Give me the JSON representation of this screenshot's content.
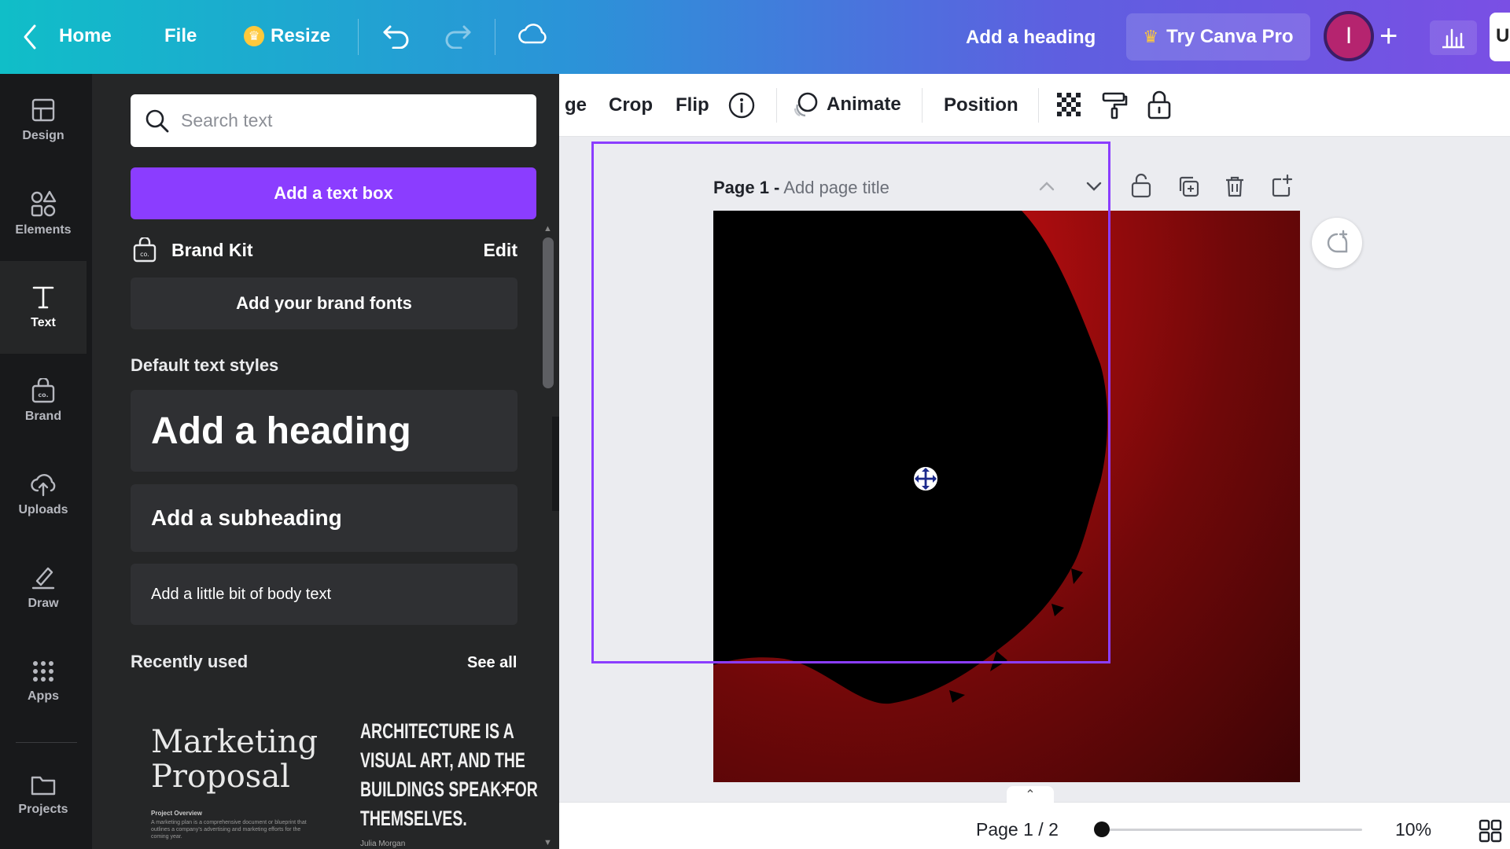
{
  "app": {
    "accent_color": "#8b3dff",
    "topbar": {
      "home_label": "Home",
      "file_label": "File",
      "resize_label": "Resize",
      "design_title": "Add a heading",
      "pro_label": "Try Canva Pro",
      "avatar_initial": "I",
      "share_label": "U"
    }
  },
  "rail": {
    "items": [
      {
        "label": "Design",
        "icon": "layout-icon"
      },
      {
        "label": "Elements",
        "icon": "shapes-icon"
      },
      {
        "label": "Text",
        "icon": "text-icon",
        "active": true
      },
      {
        "label": "Brand",
        "icon": "brand-icon"
      },
      {
        "label": "Uploads",
        "icon": "upload-icon"
      },
      {
        "label": "Draw",
        "icon": "draw-icon"
      },
      {
        "label": "Apps",
        "icon": "apps-icon"
      },
      {
        "label": "Projects",
        "icon": "folder-icon"
      }
    ]
  },
  "panel": {
    "search_placeholder": "Search text",
    "add_text_box": "Add a text box",
    "brand_kit_label": "Brand Kit",
    "brand_kit_edit": "Edit",
    "brand_fonts_button": "Add your brand fonts",
    "default_styles_title": "Default text styles",
    "heading_sample": "Add a heading",
    "subheading_sample": "Add a subheading",
    "body_sample": "Add a little bit of body text",
    "recently_used_title": "Recently used",
    "see_all": "See all",
    "recent": {
      "marketing_title_line1": "Marketing",
      "marketing_title_line2": "Proposal",
      "marketing_subtitle": "Project Overview",
      "marketing_desc": "A marketing plan is a comprehensive document or blueprint that outlines a company's advertising and marketing efforts for the coming year.",
      "arch_line1": "ARCHITECTURE IS A",
      "arch_line2": "VISUAL ART, AND THE",
      "arch_line3": "BUILDINGS SPEAK FOR",
      "arch_line4": "THEMSELVES.",
      "arch_author": "Julia Morgan"
    }
  },
  "context_toolbar": {
    "partial_label": "ge",
    "crop": "Crop",
    "flip": "Flip",
    "animate": "Animate",
    "position": "Position"
  },
  "canvas": {
    "page_prefix": "Page 1 -",
    "page_title_placeholder": "Add page title"
  },
  "footer": {
    "page_indicator": "Page 1 / 2",
    "zoom": "10%",
    "zoom_fraction": 0.0
  }
}
